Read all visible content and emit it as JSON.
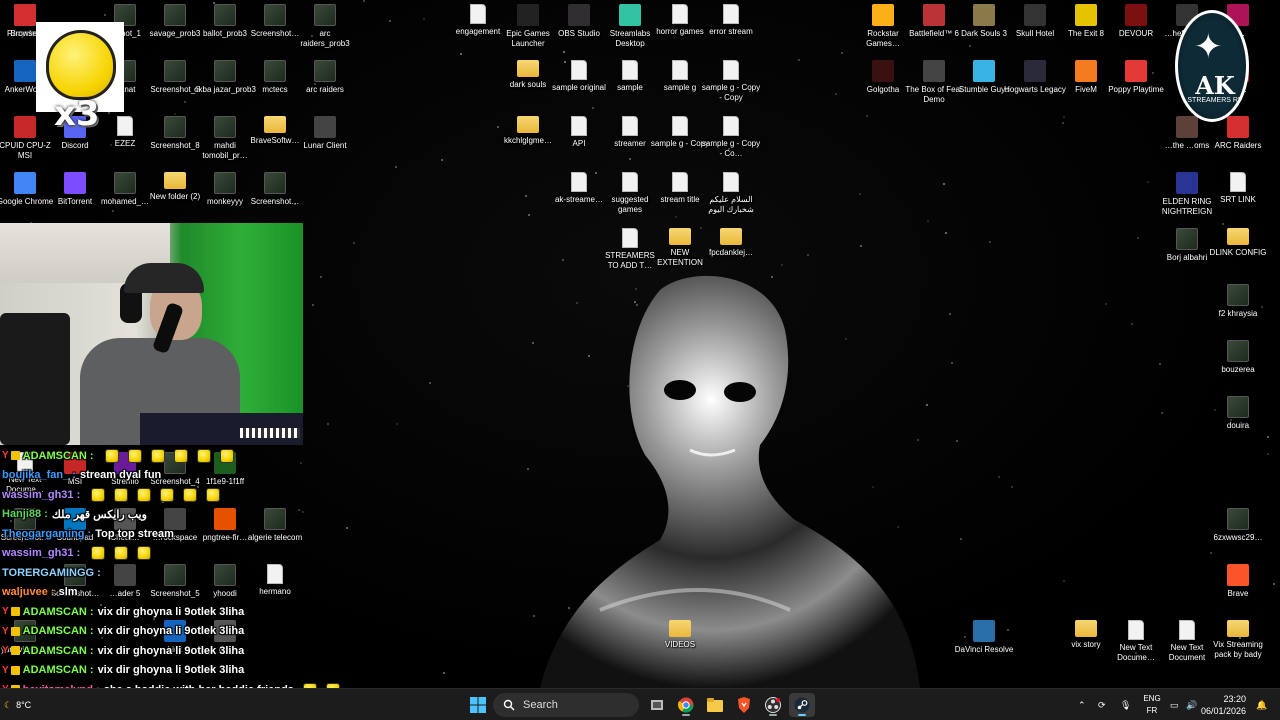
{
  "desktop_icons": [
    {
      "id": "recycle-bin",
      "label": "Recycle B",
      "kind": "app",
      "color": "#4a90d9"
    },
    {
      "id": "screenshot-1",
      "label": "…shot_1",
      "kind": "shot"
    },
    {
      "id": "savage-prob3",
      "label": "savage_prob3",
      "kind": "shot"
    },
    {
      "id": "ballot-prob3",
      "label": "ballot_prob3",
      "kind": "shot"
    },
    {
      "id": "screenshot-a",
      "label": "Screenshot…",
      "kind": "shot"
    },
    {
      "id": "arc-raiders-prob3",
      "label": "arc raiders_prob3",
      "kind": "shot"
    },
    {
      "id": "ankerwork",
      "label": "AnkerWo…",
      "kind": "app",
      "color": "#1565c0"
    },
    {
      "id": "banat",
      "label": "Banat",
      "kind": "shot"
    },
    {
      "id": "screenshot-6",
      "label": "Screenshot_6",
      "kind": "shot"
    },
    {
      "id": "okba-jazar-prob3",
      "label": "okba jazar_prob3",
      "kind": "shot"
    },
    {
      "id": "mctecs",
      "label": "mctecs",
      "kind": "shot"
    },
    {
      "id": "arc-raiders",
      "label": "arc raiders",
      "kind": "shot"
    },
    {
      "id": "cpuid",
      "label": "CPUID CPU-Z MSI",
      "kind": "app",
      "color": "#c62828"
    },
    {
      "id": "discord",
      "label": "Discord",
      "kind": "app",
      "color": "#5865f2"
    },
    {
      "id": "ezez",
      "label": "EZEZ",
      "kind": "file"
    },
    {
      "id": "screenshot-8",
      "label": "Screenshot_8",
      "kind": "shot"
    },
    {
      "id": "mahdi-tomobil",
      "label": "mahdi tomobil_pr…",
      "kind": "shot"
    },
    {
      "id": "bravesoftware",
      "label": "BraveSoftw…",
      "kind": "folder"
    },
    {
      "id": "lunar-client",
      "label": "Lunar Client",
      "kind": "app",
      "color": "#444"
    },
    {
      "id": "google-chrome",
      "label": "Google Chrome",
      "kind": "app",
      "color": "#4285f4"
    },
    {
      "id": "bittorrent",
      "label": "BitTorrent",
      "kind": "app",
      "color": "#7c4dff"
    },
    {
      "id": "mohamed",
      "label": "mohamed_…",
      "kind": "shot"
    },
    {
      "id": "new-folder-2",
      "label": "New folder (2)",
      "kind": "folder"
    },
    {
      "id": "monkeyyy",
      "label": "monkeyyy",
      "kind": "shot"
    },
    {
      "id": "screenshot-b",
      "label": "Screenshot…",
      "kind": "shot"
    },
    {
      "id": "engagement",
      "label": "engagement",
      "kind": "file"
    },
    {
      "id": "epic-games",
      "label": "Epic Games Launcher",
      "kind": "app",
      "color": "#222"
    },
    {
      "id": "obs-studio",
      "label": "OBS Studio",
      "kind": "app",
      "color": "#302e31"
    },
    {
      "id": "streamlabs",
      "label": "Streamlabs Desktop",
      "kind": "app",
      "color": "#31c3a2"
    },
    {
      "id": "horror-games",
      "label": "horror games",
      "kind": "file"
    },
    {
      "id": "error-stream",
      "label": "error stream",
      "kind": "file"
    },
    {
      "id": "dark-souls",
      "label": "dark souls",
      "kind": "folder"
    },
    {
      "id": "sample-original",
      "label": "sample original",
      "kind": "file"
    },
    {
      "id": "sample",
      "label": "sample",
      "kind": "file"
    },
    {
      "id": "sample-g",
      "label": "sample g",
      "kind": "file"
    },
    {
      "id": "sample-g-copy-copy",
      "label": "sample g - Copy - Copy",
      "kind": "file"
    },
    {
      "id": "kkchlglgme",
      "label": "kkchlglgme…",
      "kind": "folder"
    },
    {
      "id": "api",
      "label": "API",
      "kind": "file"
    },
    {
      "id": "streamer",
      "label": "streamer",
      "kind": "file"
    },
    {
      "id": "sample-g-copy",
      "label": "sample g - Copy",
      "kind": "file"
    },
    {
      "id": "sample-g-copy-co",
      "label": "sample g - Copy - Co…",
      "kind": "file"
    },
    {
      "id": "ak-streame",
      "label": "ak-streame…",
      "kind": "file"
    },
    {
      "id": "suggested-games",
      "label": "suggested games",
      "kind": "file"
    },
    {
      "id": "stream-title",
      "label": "stream title",
      "kind": "file"
    },
    {
      "id": "arabic-note",
      "label": "السلام عليكم شخبارك اليوم",
      "kind": "file"
    },
    {
      "id": "streamers-to-add",
      "label": "STREAMERS TO ADD T…",
      "kind": "file"
    },
    {
      "id": "new-extention",
      "label": "NEW EXTENTION",
      "kind": "folder"
    },
    {
      "id": "fpcdanklej",
      "label": "fpcdanklej…",
      "kind": "folder"
    },
    {
      "id": "rockstar",
      "label": "Rockstar Games…",
      "kind": "app",
      "color": "#fcaf17"
    },
    {
      "id": "battlefield-6",
      "label": "Battlefield™ 6",
      "kind": "app",
      "color": "#b33"
    },
    {
      "id": "dark-souls-3",
      "label": "Dark Souls 3",
      "kind": "app",
      "color": "#8a7a4a"
    },
    {
      "id": "skull-hotel",
      "label": "Skull Hotel",
      "kind": "app",
      "color": "#333"
    },
    {
      "id": "the-exit-8",
      "label": "The Exit 8",
      "kind": "app",
      "color": "#e6c300"
    },
    {
      "id": "devour",
      "label": "DEVOUR",
      "kind": "app",
      "color": "#7a1010"
    },
    {
      "id": "golgotha",
      "label": "Golgotha",
      "kind": "app",
      "color": "#3a1010"
    },
    {
      "id": "box-of-fear",
      "label": "The Box of Fear Demo",
      "kind": "app",
      "color": "#444"
    },
    {
      "id": "stumble-guys",
      "label": "Stumble Guys",
      "kind": "app",
      "color": "#39b3e6"
    },
    {
      "id": "hogwarts",
      "label": "Hogwarts Legacy",
      "kind": "app",
      "color": "#2a2a3a"
    },
    {
      "id": "fivem",
      "label": "FiveM",
      "kind": "app",
      "color": "#f47b20"
    },
    {
      "id": "poppy-playtime",
      "label": "Poppy Playtime",
      "kind": "app",
      "color": "#e53935"
    },
    {
      "id": "pa-partial",
      "label": "PA…",
      "kind": "app",
      "color": "#c2185b"
    },
    {
      "id": "theft-v",
      "label": "…heft …D V",
      "kind": "app",
      "color": "#333"
    },
    {
      "id": "r-partial",
      "label": "R…",
      "kind": "app",
      "color": "#ad1457"
    },
    {
      "id": "the-rooms",
      "label": "…the …oms",
      "kind": "app",
      "color": "#5d4037"
    },
    {
      "id": "arc-raiders-app",
      "label": "ARC Raiders",
      "kind": "app",
      "color": "#d32f2f"
    },
    {
      "id": "elden-ring",
      "label": "ELDEN RING NIGHTREIGN",
      "kind": "app",
      "color": "#283593"
    },
    {
      "id": "srt-link",
      "label": "SRT LINK",
      "kind": "file"
    },
    {
      "id": "borj-albahri",
      "label": "Borj albahri",
      "kind": "shot"
    },
    {
      "id": "dlink-config",
      "label": "DLINK CONFIG",
      "kind": "folder"
    },
    {
      "id": "f2-khraysia",
      "label": "f2 khraysia",
      "kind": "shot"
    },
    {
      "id": "bouzerea",
      "label": "bouzerea",
      "kind": "shot"
    },
    {
      "id": "douira",
      "label": "douira",
      "kind": "shot"
    },
    {
      "id": "6zxwwsc29",
      "label": "6zxwwsc29…",
      "kind": "shot"
    },
    {
      "id": "brave",
      "label": "Brave",
      "kind": "app",
      "color": "#fb542b"
    },
    {
      "id": "davinci",
      "label": "DaVinci Resolve",
      "kind": "app",
      "color": "#2a6ea8"
    },
    {
      "id": "vix-story",
      "label": "vix story",
      "kind": "folder"
    },
    {
      "id": "new-text-doc-1",
      "label": "New Text Docume…",
      "kind": "file"
    },
    {
      "id": "new-text-doc-2",
      "label": "New Text Document",
      "kind": "file"
    },
    {
      "id": "vix-streaming",
      "label": "Vix Streaming pack by bady",
      "kind": "folder"
    },
    {
      "id": "videos",
      "label": "VIDEOS",
      "kind": "folder"
    },
    {
      "id": "new-text-doc-3",
      "label": "New Text Docume…",
      "kind": "file"
    },
    {
      "id": "msi",
      "label": "MSI",
      "kind": "app",
      "color": "#c62828"
    },
    {
      "id": "stremio",
      "label": "Stremio",
      "kind": "app",
      "color": "#6a1b9a"
    },
    {
      "id": "screenshot-4",
      "label": "Screenshot_4",
      "kind": "shot"
    },
    {
      "id": "1f1e9",
      "label": "1f1e9-1f1ff",
      "kind": "app",
      "color": "#1b5e20"
    },
    {
      "id": "screenshot-c",
      "label": "Screenshot…",
      "kind": "shot"
    },
    {
      "id": "soundpad",
      "label": "Soundpad",
      "kind": "app",
      "color": "#0277bd"
    },
    {
      "id": "cheat",
      "label": "Cheat…",
      "kind": "app",
      "color": "#555"
    },
    {
      "id": "rockspace",
      "label": "…rockspace",
      "kind": "app",
      "color": "#444"
    },
    {
      "id": "pngtree",
      "label": "pngtree-fir…",
      "kind": "app",
      "color": "#e65100"
    },
    {
      "id": "algerie-telecom",
      "label": "algerie telecom",
      "kind": "shot"
    },
    {
      "id": "screenshot-d",
      "label": "Screenshot…",
      "kind": "shot"
    },
    {
      "id": "loader-5",
      "label": "…ader 5",
      "kind": "app",
      "color": "#444"
    },
    {
      "id": "screenshot-5",
      "label": "Screenshot_5",
      "kind": "shot"
    },
    {
      "id": "yhoodi",
      "label": "yhoodi",
      "kind": "shot"
    },
    {
      "id": "hermano",
      "label": "hermano",
      "kind": "file"
    },
    {
      "id": "yungvixus",
      "label": "yungvixus_…",
      "kind": "shot"
    },
    {
      "id": "link",
      "label": "Link",
      "kind": "app",
      "color": "#1565c0"
    },
    {
      "id": "cnx",
      "label": "cnx",
      "kind": "app",
      "color": "#555"
    },
    {
      "id": "browser",
      "label": "Browser",
      "kind": "app",
      "color": "#d32f2f"
    }
  ],
  "overlay": {
    "emote_multiplier": "x3",
    "logo_text": "AK",
    "logo_subtext": "STREAMERS RP"
  },
  "chat": [
    {
      "user": "ADAMSCAN",
      "user_color": "#7dff4a",
      "prefix": "Y",
      "badge": true,
      "message": "",
      "emotes": 6
    },
    {
      "user": "boujika_fan_",
      "user_color": "#3d9bff",
      "prefix": "",
      "badge": false,
      "message": "stream dyal fun",
      "emotes": 0
    },
    {
      "user": "wassim_gh31",
      "user_color": "#b388ff",
      "prefix": "",
      "badge": false,
      "message": "",
      "emotes": 6
    },
    {
      "user": "Hanji88",
      "user_color": "#5cd65c",
      "prefix": "",
      "badge": false,
      "message": "ويب رايكس قهر ملك",
      "emotes": 0
    },
    {
      "user": "Theogargaming",
      "user_color": "#3d9bff",
      "prefix": "",
      "badge": false,
      "message": "Top top stream",
      "emotes": 0
    },
    {
      "user": "wassim_gh31",
      "user_color": "#b388ff",
      "prefix": "",
      "badge": false,
      "message": "",
      "emotes": 3
    },
    {
      "user": "TORERGAMINGG",
      "user_color": "#8fd0ff",
      "prefix": "",
      "badge": false,
      "message": "",
      "emotes": 0
    },
    {
      "user": "waljuvee",
      "user_color": "#ff8a3d",
      "prefix": "",
      "badge": false,
      "message": "slm",
      "emotes": 0
    },
    {
      "user": "ADAMSCAN",
      "user_color": "#7dff4a",
      "prefix": "Y",
      "badge": true,
      "message": "vix dir ghoyna li 9otlek 3liha",
      "emotes": 0
    },
    {
      "user": "ADAMSCAN",
      "user_color": "#7dff4a",
      "prefix": "Y",
      "badge": true,
      "message": "vix dir ghoyna li 9otlek 3liha",
      "emotes": 0
    },
    {
      "user": "ADAMSCAN",
      "user_color": "#7dff4a",
      "prefix": "Y",
      "badge": true,
      "message": "vix dir ghoyna li 9otlek 3liha",
      "emotes": 0
    },
    {
      "user": "ADAMSCAN",
      "user_color": "#7dff4a",
      "prefix": "Y",
      "badge": true,
      "message": "vix dir ghoyna li 9otlek 3liha",
      "emotes": 0
    },
    {
      "user": "heyitsmelynd",
      "user_color": "#ff5ca8",
      "prefix": "Y",
      "badge": true,
      "message": "she a baddie with her baddie friends",
      "emotes": 2
    },
    {
      "user": "ADAMSCAN",
      "user_color": "#7dff4a",
      "prefix": "Y",
      "badge": true,
      "message": "vix dir ghoyna li 9otlek 3liha",
      "emotes": 0
    }
  ],
  "taskbar": {
    "search_placeholder": "Search",
    "apps": [
      "windows-start",
      "search",
      "task-view",
      "chrome",
      "file-explorer",
      "brave",
      "obs",
      "steam"
    ],
    "language_top": "ENG",
    "language_bottom": "FR",
    "time": "23:20",
    "date": "06/01/2026",
    "weather": "8°C"
  }
}
